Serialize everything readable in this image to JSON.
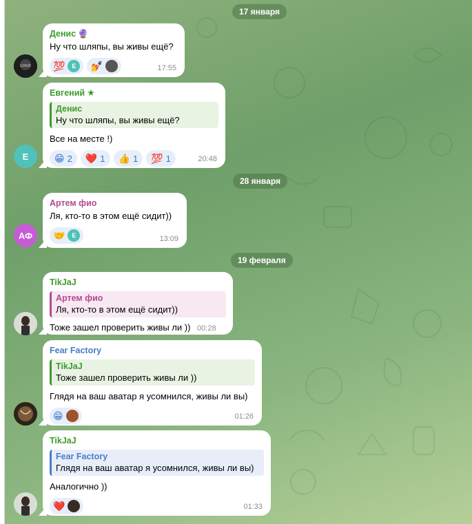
{
  "colors": {
    "accent_reaction": "#3a73c9",
    "reaction_bg": "#e6eef9",
    "green_name": "#3e9a2d",
    "pink_name": "#b24a92",
    "blue_name": "#4a7cc9",
    "avatar_e": "#4fc2b9",
    "avatar_af": "#c65bd6"
  },
  "dates": {
    "d1": "17 января",
    "d2": "28 января",
    "d3": "19 февраля"
  },
  "messages": [
    {
      "sender": "Денис",
      "text": "Ну что шляпы, вы живы ещё?",
      "time": "17:55",
      "reactions": [
        "💯",
        "😊",
        "🤞"
      ]
    },
    {
      "sender": "Евгений",
      "reply_name": "Денис",
      "reply_text": "Ну что шляпы, вы живы ещё?",
      "text": "Все на месте !)",
      "time": "20:48",
      "avatar_letter": "Е",
      "reactions": [
        {
          "emoji": "😁",
          "count": "2"
        },
        {
          "emoji": "❤️",
          "count": "1"
        },
        {
          "emoji": "👍",
          "count": "1"
        },
        {
          "emoji": "💯",
          "count": "1"
        }
      ]
    },
    {
      "sender": "Артем фио",
      "text": "Ля, кто-то в этом ещё сидит))",
      "time": "13:09",
      "avatar_letters": "АФ",
      "reactions": [
        "🤝"
      ]
    },
    {
      "sender": "TikJaJ",
      "reply_name": "Артем фио",
      "reply_text": "Ля, кто-то в этом ещё сидит))",
      "text": "Тоже зашел проверить живы ли ))",
      "time": "00:28"
    },
    {
      "sender": "Fear Factory",
      "reply_name": "TikJaJ",
      "reply_text": "Тоже зашел проверить живы ли ))",
      "text": "Глядя на ваш аватар я усомнился, живы ли вы)",
      "time": "01:26",
      "reactions": [
        "😁"
      ]
    },
    {
      "sender": "TikJaJ",
      "reply_name": "Fear Factory",
      "reply_text": "Глядя на ваш аватар я усомнился, живы ли вы)",
      "text": "Аналогично ))",
      "time": "01:33",
      "reactions": [
        "❤️"
      ]
    }
  ],
  "mini_avatar_letter": "Е"
}
